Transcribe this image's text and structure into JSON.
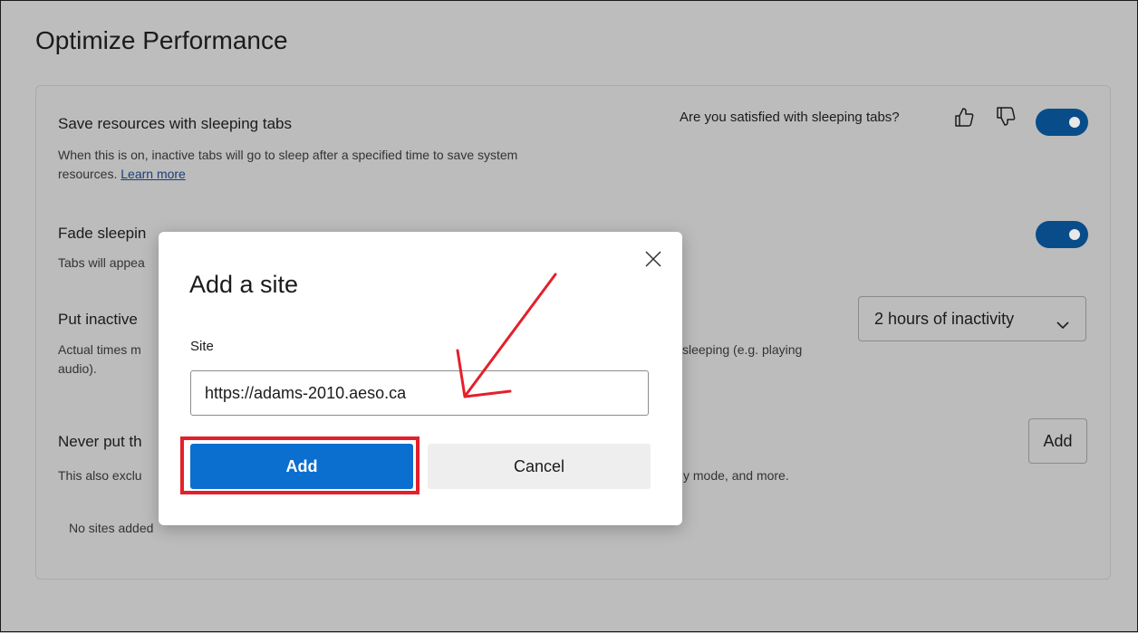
{
  "page": {
    "title": "Optimize Performance"
  },
  "settings": {
    "sleeping_tabs": {
      "title": "Save resources with sleeping tabs",
      "desc_line1": "When this is on, inactive tabs will go to sleep after a specified time to save system",
      "desc_line2_prefix": "resources. ",
      "learn_more": "Learn more",
      "feedback_question": "Are you satisfied with sleeping tabs?",
      "toggle_on": true
    },
    "fade_tabs": {
      "title_visible": "Fade sleepin",
      "desc_visible": "Tabs will appea",
      "toggle_on": true
    },
    "inactive": {
      "title_visible": "Put inactive",
      "desc_left_line1": "Actual times m",
      "desc_left_line2": "audio).",
      "desc_right": "sleeping (e.g. playing",
      "select_value": "2 hours of inactivity"
    },
    "never_sleep": {
      "title_visible": "Never put th",
      "desc_left": "This also exclu",
      "desc_right": "y mode, and more.",
      "add_label": "Add",
      "empty_text": "No sites added"
    }
  },
  "dialog": {
    "title": "Add a site",
    "field_label": "Site",
    "field_value": "https://adams-2010.aeso.ca",
    "primary_label": "Add",
    "secondary_label": "Cancel"
  },
  "icons": [
    "thumbs-up-icon",
    "thumbs-down-icon",
    "close-icon",
    "chevron-down-icon"
  ],
  "colors": {
    "toggle": "#084d8a",
    "primary": "#0b6fd0",
    "annotation": "#e3202b",
    "link": "#1a3e78"
  }
}
